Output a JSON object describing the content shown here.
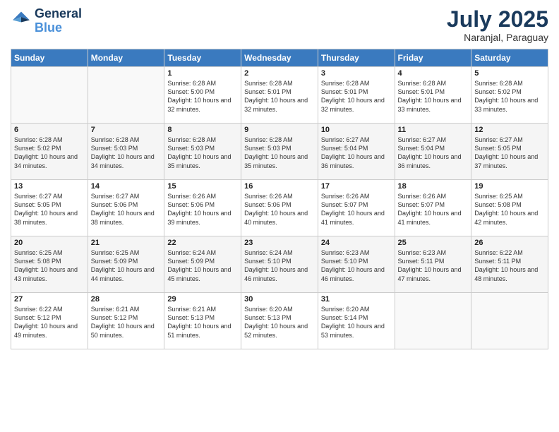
{
  "header": {
    "logo_line1": "General",
    "logo_line2": "Blue",
    "month": "July 2025",
    "location": "Naranjal, Paraguay"
  },
  "days_of_week": [
    "Sunday",
    "Monday",
    "Tuesday",
    "Wednesday",
    "Thursday",
    "Friday",
    "Saturday"
  ],
  "weeks": [
    [
      {
        "day": "",
        "sunrise": "",
        "sunset": "",
        "daylight": ""
      },
      {
        "day": "",
        "sunrise": "",
        "sunset": "",
        "daylight": ""
      },
      {
        "day": "1",
        "sunrise": "Sunrise: 6:28 AM",
        "sunset": "Sunset: 5:00 PM",
        "daylight": "Daylight: 10 hours and 32 minutes."
      },
      {
        "day": "2",
        "sunrise": "Sunrise: 6:28 AM",
        "sunset": "Sunset: 5:01 PM",
        "daylight": "Daylight: 10 hours and 32 minutes."
      },
      {
        "day": "3",
        "sunrise": "Sunrise: 6:28 AM",
        "sunset": "Sunset: 5:01 PM",
        "daylight": "Daylight: 10 hours and 32 minutes."
      },
      {
        "day": "4",
        "sunrise": "Sunrise: 6:28 AM",
        "sunset": "Sunset: 5:01 PM",
        "daylight": "Daylight: 10 hours and 33 minutes."
      },
      {
        "day": "5",
        "sunrise": "Sunrise: 6:28 AM",
        "sunset": "Sunset: 5:02 PM",
        "daylight": "Daylight: 10 hours and 33 minutes."
      }
    ],
    [
      {
        "day": "6",
        "sunrise": "Sunrise: 6:28 AM",
        "sunset": "Sunset: 5:02 PM",
        "daylight": "Daylight: 10 hours and 34 minutes."
      },
      {
        "day": "7",
        "sunrise": "Sunrise: 6:28 AM",
        "sunset": "Sunset: 5:03 PM",
        "daylight": "Daylight: 10 hours and 34 minutes."
      },
      {
        "day": "8",
        "sunrise": "Sunrise: 6:28 AM",
        "sunset": "Sunset: 5:03 PM",
        "daylight": "Daylight: 10 hours and 35 minutes."
      },
      {
        "day": "9",
        "sunrise": "Sunrise: 6:28 AM",
        "sunset": "Sunset: 5:03 PM",
        "daylight": "Daylight: 10 hours and 35 minutes."
      },
      {
        "day": "10",
        "sunrise": "Sunrise: 6:27 AM",
        "sunset": "Sunset: 5:04 PM",
        "daylight": "Daylight: 10 hours and 36 minutes."
      },
      {
        "day": "11",
        "sunrise": "Sunrise: 6:27 AM",
        "sunset": "Sunset: 5:04 PM",
        "daylight": "Daylight: 10 hours and 36 minutes."
      },
      {
        "day": "12",
        "sunrise": "Sunrise: 6:27 AM",
        "sunset": "Sunset: 5:05 PM",
        "daylight": "Daylight: 10 hours and 37 minutes."
      }
    ],
    [
      {
        "day": "13",
        "sunrise": "Sunrise: 6:27 AM",
        "sunset": "Sunset: 5:05 PM",
        "daylight": "Daylight: 10 hours and 38 minutes."
      },
      {
        "day": "14",
        "sunrise": "Sunrise: 6:27 AM",
        "sunset": "Sunset: 5:06 PM",
        "daylight": "Daylight: 10 hours and 38 minutes."
      },
      {
        "day": "15",
        "sunrise": "Sunrise: 6:26 AM",
        "sunset": "Sunset: 5:06 PM",
        "daylight": "Daylight: 10 hours and 39 minutes."
      },
      {
        "day": "16",
        "sunrise": "Sunrise: 6:26 AM",
        "sunset": "Sunset: 5:06 PM",
        "daylight": "Daylight: 10 hours and 40 minutes."
      },
      {
        "day": "17",
        "sunrise": "Sunrise: 6:26 AM",
        "sunset": "Sunset: 5:07 PM",
        "daylight": "Daylight: 10 hours and 41 minutes."
      },
      {
        "day": "18",
        "sunrise": "Sunrise: 6:26 AM",
        "sunset": "Sunset: 5:07 PM",
        "daylight": "Daylight: 10 hours and 41 minutes."
      },
      {
        "day": "19",
        "sunrise": "Sunrise: 6:25 AM",
        "sunset": "Sunset: 5:08 PM",
        "daylight": "Daylight: 10 hours and 42 minutes."
      }
    ],
    [
      {
        "day": "20",
        "sunrise": "Sunrise: 6:25 AM",
        "sunset": "Sunset: 5:08 PM",
        "daylight": "Daylight: 10 hours and 43 minutes."
      },
      {
        "day": "21",
        "sunrise": "Sunrise: 6:25 AM",
        "sunset": "Sunset: 5:09 PM",
        "daylight": "Daylight: 10 hours and 44 minutes."
      },
      {
        "day": "22",
        "sunrise": "Sunrise: 6:24 AM",
        "sunset": "Sunset: 5:09 PM",
        "daylight": "Daylight: 10 hours and 45 minutes."
      },
      {
        "day": "23",
        "sunrise": "Sunrise: 6:24 AM",
        "sunset": "Sunset: 5:10 PM",
        "daylight": "Daylight: 10 hours and 46 minutes."
      },
      {
        "day": "24",
        "sunrise": "Sunrise: 6:23 AM",
        "sunset": "Sunset: 5:10 PM",
        "daylight": "Daylight: 10 hours and 46 minutes."
      },
      {
        "day": "25",
        "sunrise": "Sunrise: 6:23 AM",
        "sunset": "Sunset: 5:11 PM",
        "daylight": "Daylight: 10 hours and 47 minutes."
      },
      {
        "day": "26",
        "sunrise": "Sunrise: 6:22 AM",
        "sunset": "Sunset: 5:11 PM",
        "daylight": "Daylight: 10 hours and 48 minutes."
      }
    ],
    [
      {
        "day": "27",
        "sunrise": "Sunrise: 6:22 AM",
        "sunset": "Sunset: 5:12 PM",
        "daylight": "Daylight: 10 hours and 49 minutes."
      },
      {
        "day": "28",
        "sunrise": "Sunrise: 6:21 AM",
        "sunset": "Sunset: 5:12 PM",
        "daylight": "Daylight: 10 hours and 50 minutes."
      },
      {
        "day": "29",
        "sunrise": "Sunrise: 6:21 AM",
        "sunset": "Sunset: 5:13 PM",
        "daylight": "Daylight: 10 hours and 51 minutes."
      },
      {
        "day": "30",
        "sunrise": "Sunrise: 6:20 AM",
        "sunset": "Sunset: 5:13 PM",
        "daylight": "Daylight: 10 hours and 52 minutes."
      },
      {
        "day": "31",
        "sunrise": "Sunrise: 6:20 AM",
        "sunset": "Sunset: 5:14 PM",
        "daylight": "Daylight: 10 hours and 53 minutes."
      },
      {
        "day": "",
        "sunrise": "",
        "sunset": "",
        "daylight": ""
      },
      {
        "day": "",
        "sunrise": "",
        "sunset": "",
        "daylight": ""
      }
    ]
  ]
}
